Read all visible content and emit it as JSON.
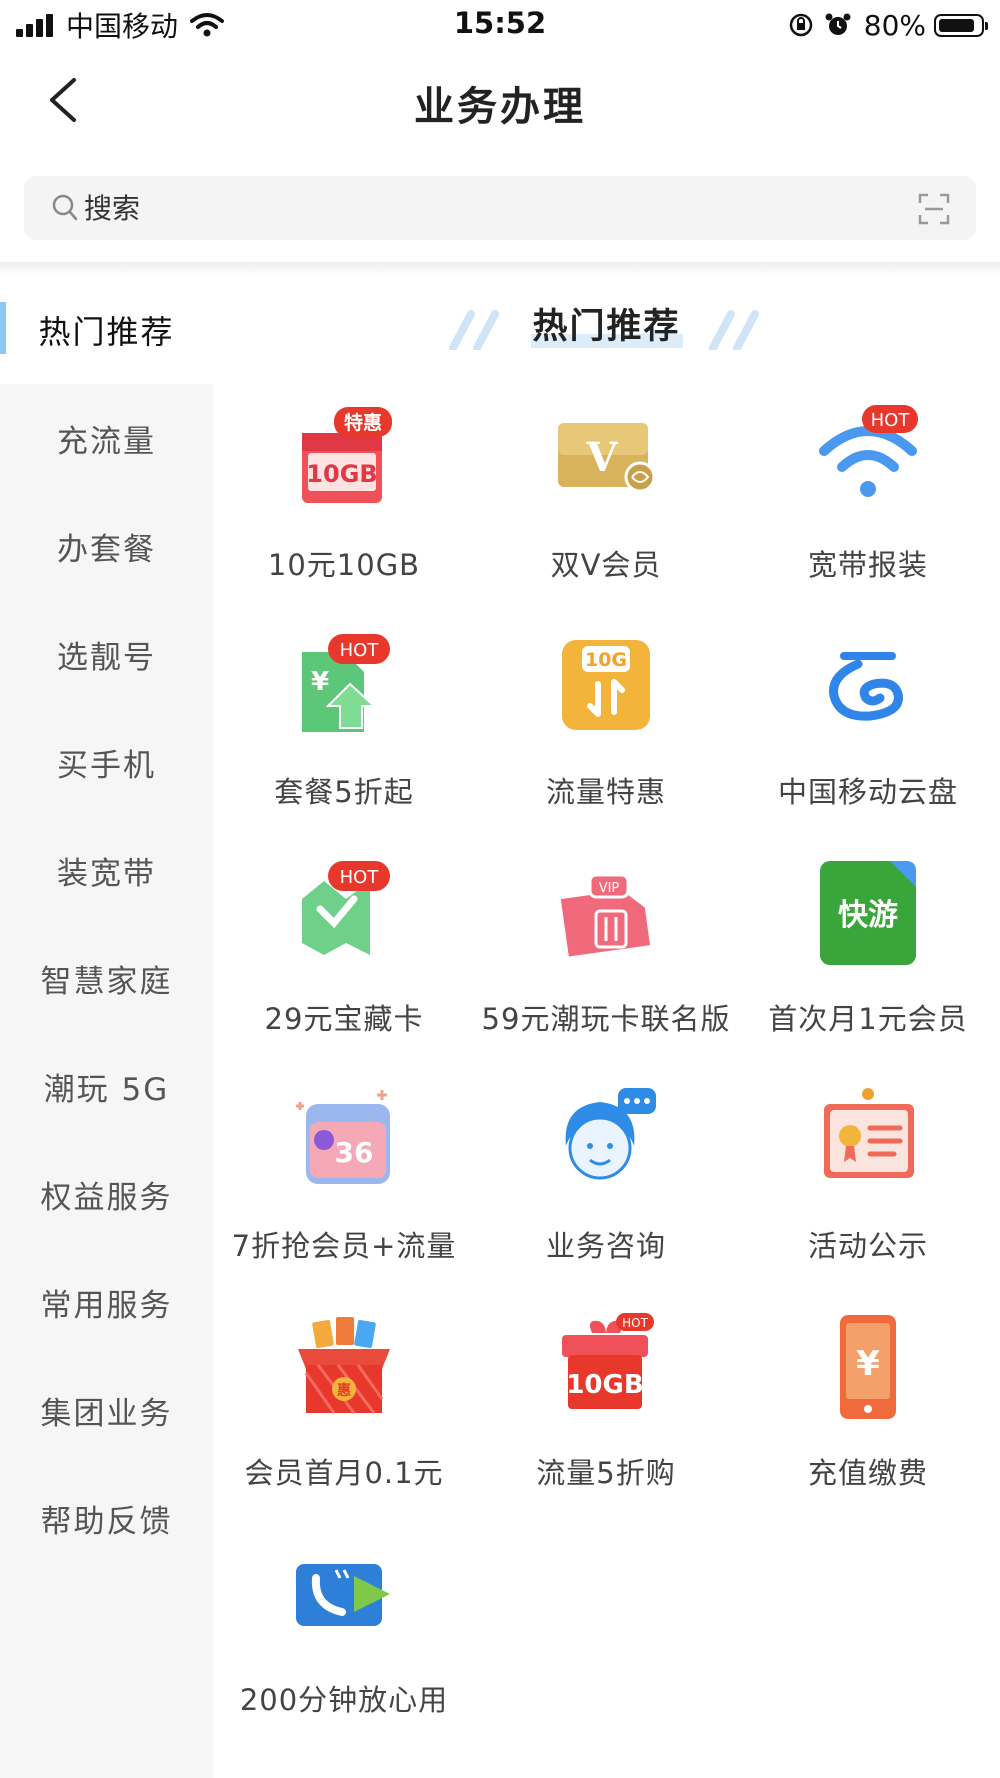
{
  "status_bar": {
    "carrier": "中国移动",
    "time": "15:52",
    "battery": "80%"
  },
  "nav": {
    "title": "业务办理"
  },
  "search": {
    "placeholder": "搜索"
  },
  "sidebar": {
    "items": [
      {
        "label": "热门推荐",
        "active": true
      },
      {
        "label": "充流量"
      },
      {
        "label": "办套餐"
      },
      {
        "label": "选靓号"
      },
      {
        "label": "买手机"
      },
      {
        "label": "装宽带"
      },
      {
        "label": "智慧家庭"
      },
      {
        "label": "潮玩 5G"
      },
      {
        "label": "权益服务"
      },
      {
        "label": "常用服务"
      },
      {
        "label": "集团业务"
      },
      {
        "label": "帮助反馈"
      }
    ]
  },
  "section": {
    "title": "热门推荐"
  },
  "grid": {
    "items": [
      {
        "label": "10元10GB",
        "icon": "gift-10gb-icon",
        "badge": "特惠",
        "icon_text": "10GB"
      },
      {
        "label": "双V会员",
        "icon": "double-v-card-icon",
        "icon_text": "V"
      },
      {
        "label": "宽带报装",
        "icon": "wifi-icon",
        "badge": "HOT"
      },
      {
        "label": "套餐5折起",
        "icon": "package-discount-icon",
        "badge": "HOT",
        "icon_text": "¥"
      },
      {
        "label": "流量特惠",
        "icon": "data-10g-icon",
        "icon_text": "10G"
      },
      {
        "label": "中国移动云盘",
        "icon": "cloud-disk-icon"
      },
      {
        "label": "29元宝藏卡",
        "icon": "treasure-card-icon",
        "badge": "HOT"
      },
      {
        "label": "59元潮玩卡联名版",
        "icon": "vip-sim-card-icon",
        "icon_text": "VIP"
      },
      {
        "label": "首次月1元会员",
        "icon": "kuaiyou-app-icon",
        "icon_text": "快游"
      },
      {
        "label": "7折抢会员+流量",
        "icon": "coupon-36-icon",
        "icon_text": "36"
      },
      {
        "label": "业务咨询",
        "icon": "customer-service-icon"
      },
      {
        "label": "活动公示",
        "icon": "notice-board-icon"
      },
      {
        "label": "会员首月0.1元",
        "icon": "gift-box-icon",
        "icon_text": "惠"
      },
      {
        "label": "流量5折购",
        "icon": "gift-10gb-hot-icon",
        "badge": "HOT",
        "icon_text": "10GB"
      },
      {
        "label": "充值缴费",
        "icon": "recharge-phone-icon",
        "icon_text": "¥"
      },
      {
        "label": "200分钟放心用",
        "icon": "call-minutes-icon"
      }
    ]
  },
  "colors": {
    "accent_blue": "#8cc8f4",
    "badge_red": "#e8382c",
    "sidebar_bg": "#f6f6f6"
  }
}
